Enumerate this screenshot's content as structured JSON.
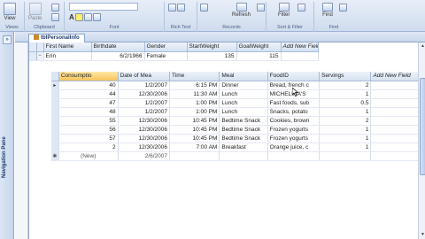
{
  "ribbon": {
    "items": [
      {
        "key": "view",
        "label": "View"
      },
      {
        "key": "paste",
        "label": "Paste"
      },
      {
        "key": "calibri_box",
        "label": ""
      },
      {
        "key": "refresh",
        "label": "Refresh"
      },
      {
        "key": "filter",
        "label": "Filter"
      },
      {
        "key": "find",
        "label": "Find"
      }
    ],
    "groups": [
      "Views",
      "Clipboard",
      "Font",
      "Rich Text",
      "Records",
      "Sort & Filter",
      "Find"
    ]
  },
  "navigation_pane": {
    "label": "Navigation Pane"
  },
  "document_tab": {
    "label": "tblPersonalInfo"
  },
  "parent_table": {
    "columns": [
      "First Name",
      "Birthdate",
      "Gender",
      "StartWeight",
      "GoalWeight",
      "Add New Field"
    ],
    "row": [
      "Erin",
      "6/2/1966",
      "Female",
      "135",
      "115",
      ""
    ]
  },
  "sub_table": {
    "columns": [
      "Consumptio",
      "Date of Mea",
      "Time",
      "Meal",
      "FoodID",
      "Servings",
      "Add New Field"
    ],
    "rows": [
      [
        "40",
        "1/2/2007",
        "6:15 PM",
        "Dinner",
        "Bread, french c",
        "2",
        ""
      ],
      [
        "44",
        "12/30/2006",
        "11:30 AM",
        "Lunch",
        "MICHELINA'S",
        "1",
        ""
      ],
      [
        "47",
        "1/2/2007",
        "1:00 PM",
        "Lunch",
        "Fast foods, sub",
        "0.5",
        ""
      ],
      [
        "48",
        "1/2/2007",
        "1:00 PM",
        "Lunch",
        "Snacks, potato",
        "1",
        ""
      ],
      [
        "55",
        "12/30/2006",
        "10:45 PM",
        "Bedtime Snack",
        "Cookies, brown",
        "2",
        ""
      ],
      [
        "56",
        "12/30/2006",
        "10:45 PM",
        "Bedtime Snack",
        "Frozen yogurts",
        "1",
        ""
      ],
      [
        "57",
        "12/30/2006",
        "10:45 PM",
        "Bedtime Snack",
        "Frozen yogurts",
        "1",
        ""
      ],
      [
        "2",
        "12/30/2006",
        "7:00 AM",
        "Breakfast",
        "Orange juice, c",
        "1",
        ""
      ]
    ],
    "new_row": [
      "(New)",
      "2/6/2007",
      "",
      "",
      "",
      "",
      ""
    ]
  }
}
